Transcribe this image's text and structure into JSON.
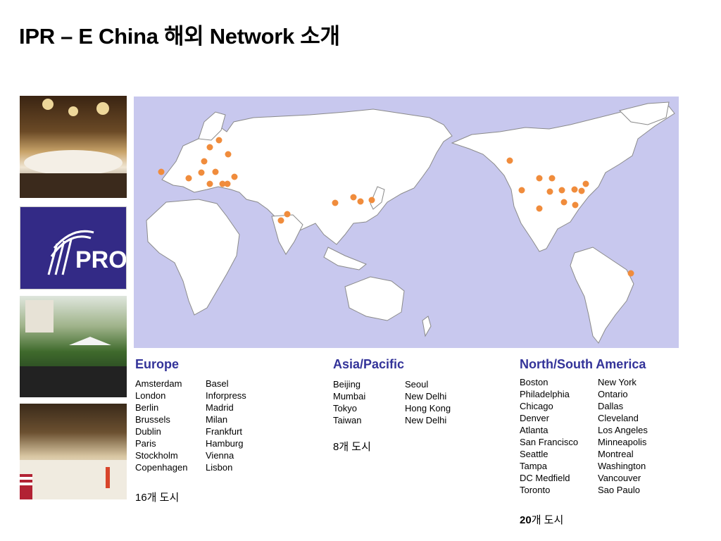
{
  "title": "IPR – E China 해외 Network 소개",
  "logo": {
    "text": "PROI"
  },
  "regions": {
    "europe": {
      "title": "Europe",
      "col1": [
        "Amsterdam",
        "London",
        "Berlin",
        "Brussels",
        "Dublin",
        "Paris",
        "Stockholm",
        "Copenhagen"
      ],
      "col2": [
        "Basel",
        "Inforpress",
        "Madrid",
        "Milan",
        "Frankfurt",
        "Hamburg",
        "Vienna",
        "Lisbon"
      ],
      "count": "16개 도시"
    },
    "asia": {
      "title": "Asia/Pacific",
      "col1": [
        "Beijing",
        "Mumbai",
        "Tokyo",
        "Taiwan"
      ],
      "col2": [
        "Seoul",
        "New Delhi",
        "Hong Kong",
        "New Delhi"
      ],
      "count": "8개 도시"
    },
    "america": {
      "title": "North/South America",
      "col1": [
        "Boston",
        "Philadelphia",
        "Chicago",
        "Denver",
        "Atlanta",
        "San Francisco",
        "Seattle",
        "Tampa",
        "DC   Medfield",
        "Toronto"
      ],
      "col2": [
        "New York",
        "Ontario",
        "Dallas",
        "Cleveland",
        "Los Angeles",
        "Minneapolis",
        "Montreal",
        "Washington",
        "Vancouver",
        "Sao Paulo"
      ],
      "count_num": "20",
      "count_suffix": "개 도시"
    }
  },
  "colors": {
    "map_ocean": "#c8c8ee",
    "land": "#ffffff",
    "marker": "#f08c3c",
    "heading": "#333399"
  }
}
